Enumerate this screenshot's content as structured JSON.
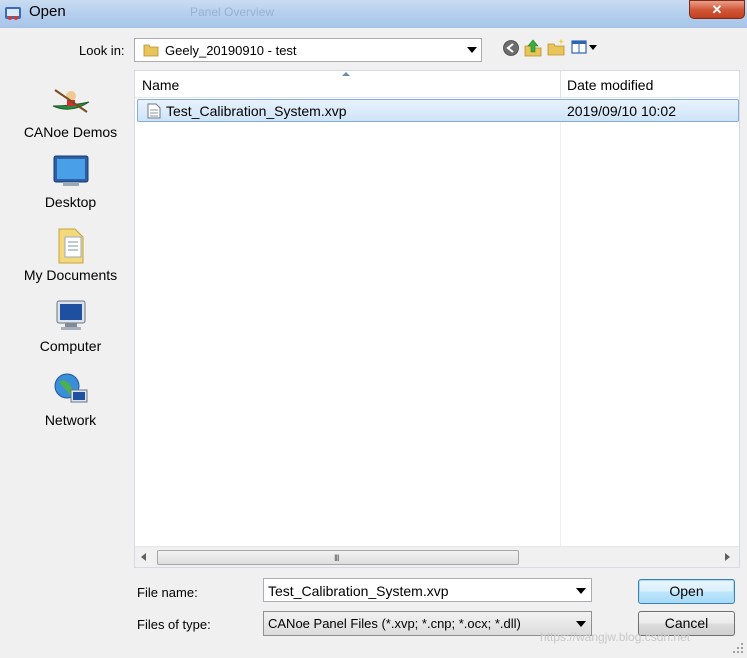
{
  "window": {
    "title": "Open",
    "close_label": "✕",
    "background_title_ghost": "Panel Overview"
  },
  "toolbar": {
    "look_in_label": "Look in:",
    "look_in_value": "Geely_20190910 - test",
    "icons": [
      "back-icon",
      "up-folder-icon",
      "new-folder-icon",
      "view-menu-icon"
    ]
  },
  "places": [
    {
      "label": "CANoe Demos",
      "icon": "canoe-demos-icon"
    },
    {
      "label": "Desktop",
      "icon": "desktop-icon"
    },
    {
      "label": "My Documents",
      "icon": "my-documents-icon"
    },
    {
      "label": "Computer",
      "icon": "computer-icon"
    },
    {
      "label": "Network",
      "icon": "network-icon"
    }
  ],
  "filelist": {
    "columns": [
      "Name",
      "Date modified"
    ],
    "rows": [
      {
        "name": "Test_Calibration_System.xvp",
        "date": "2019/09/10 10:02",
        "selected": true
      }
    ],
    "scroll_grip": "III"
  },
  "form": {
    "file_name_label": "File name:",
    "file_name_value": "Test_Calibration_System.xvp",
    "file_type_label": "Files of type:",
    "file_type_value": "CANoe Panel Files (*.xvp; *.cnp; *.ocx; *.dll)",
    "open_label": "Open",
    "cancel_label": "Cancel"
  },
  "watermark": "https://wangjw.blog.csdn.net",
  "colors": {
    "accent": "#3c7fb1",
    "selection": "#cfe4f8",
    "close": "#c2401f"
  }
}
